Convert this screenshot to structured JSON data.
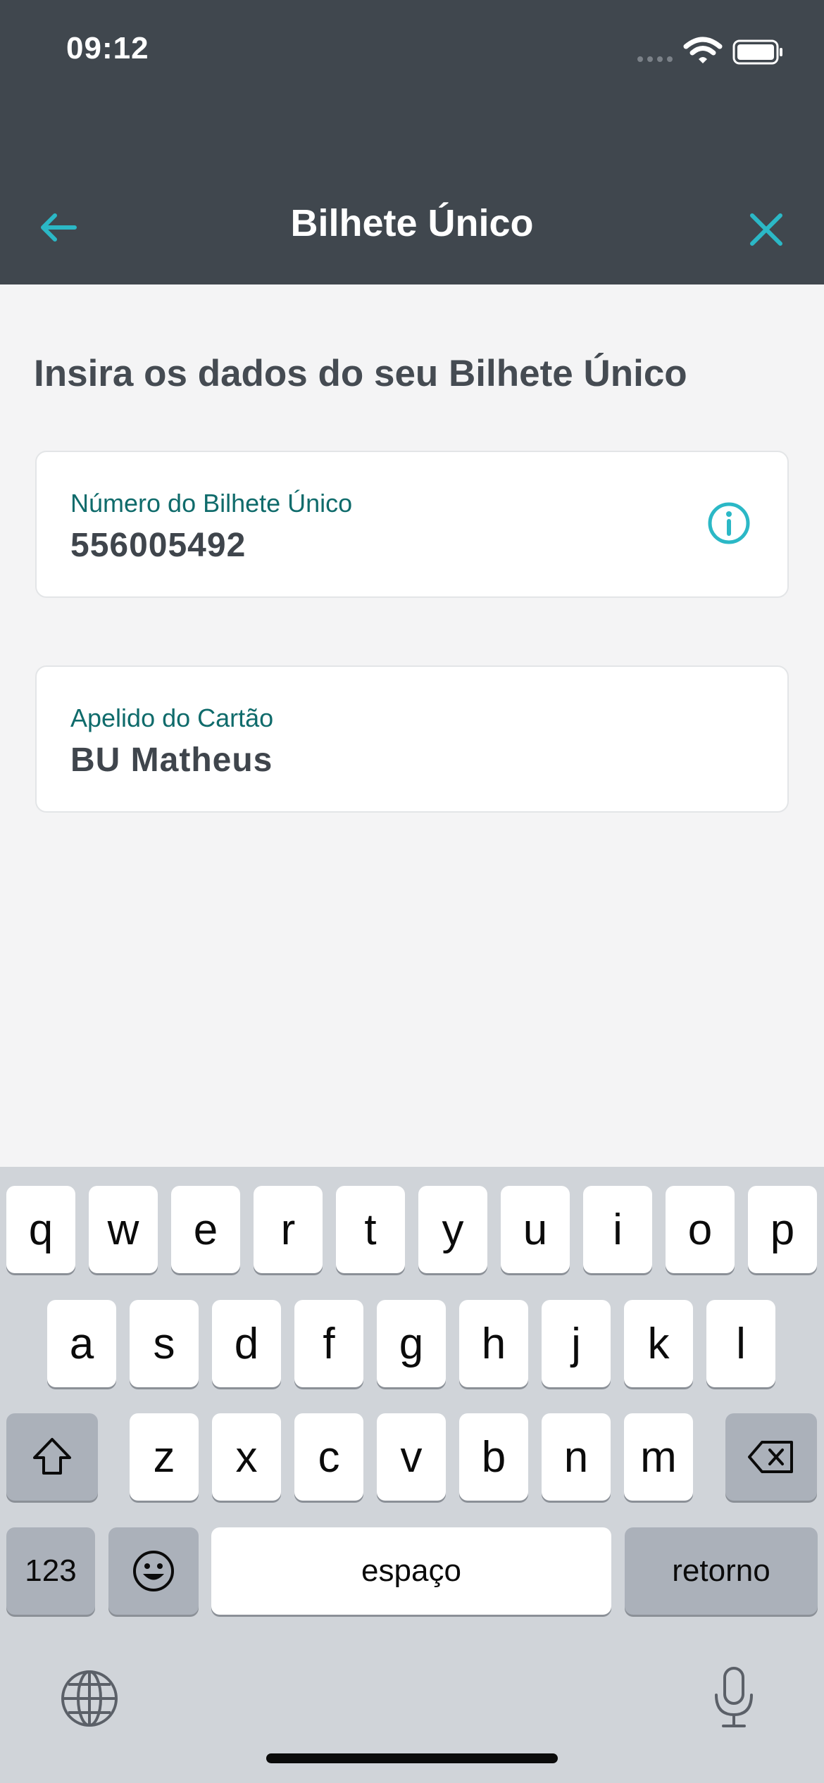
{
  "status_bar": {
    "time": "09:12",
    "icons": [
      "signal-icon",
      "wifi-icon",
      "battery-icon"
    ]
  },
  "header": {
    "title": "Bilhete Único",
    "back_icon": "arrow-left-icon",
    "close_icon": "close-icon"
  },
  "colors": {
    "header_bg": "#40474e",
    "accent": "#2bb8c6",
    "label": "#0f6b6b",
    "text_dark": "#454b52"
  },
  "main": {
    "heading": "Insira os dados do seu Bilhete Único",
    "fields": [
      {
        "label": "Número do Bilhete Único",
        "value": "556005492",
        "icon": "info-icon"
      },
      {
        "label": "Apelido do Cartão",
        "value": "BU Matheus"
      }
    ]
  },
  "keyboard": {
    "row1": [
      "q",
      "w",
      "e",
      "r",
      "t",
      "y",
      "u",
      "i",
      "o",
      "p"
    ],
    "row2": [
      "a",
      "s",
      "d",
      "f",
      "g",
      "h",
      "j",
      "k",
      "l"
    ],
    "row3": [
      "z",
      "x",
      "c",
      "v",
      "b",
      "n",
      "m"
    ],
    "numbers_label": "123",
    "space_label": "espaço",
    "return_label": "retorno",
    "icons": [
      "shift-icon",
      "backspace-icon",
      "emoji-icon",
      "globe-icon",
      "microphone-icon"
    ]
  }
}
